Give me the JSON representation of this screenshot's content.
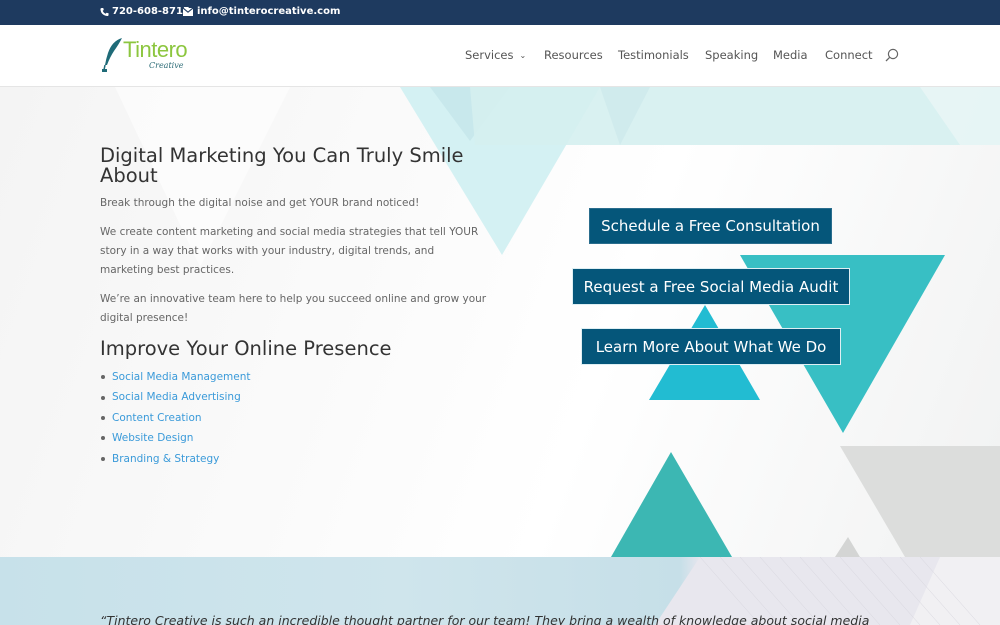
{
  "topbar": {
    "phone": "720-608-8715",
    "email": "info@tinterocreative.com",
    "phone_icon": "phone-icon",
    "email_icon": "envelope-icon"
  },
  "header": {
    "logo": {
      "word": "Tintero",
      "sub": "Creative"
    },
    "nav": [
      {
        "label": "Services",
        "has_dropdown": true
      },
      {
        "label": "Resources"
      },
      {
        "label": "Testimonials"
      },
      {
        "label": "Speaking"
      },
      {
        "label": "Media"
      },
      {
        "label": "Connect"
      }
    ],
    "search_icon": "search-icon"
  },
  "hero": {
    "title": "Digital Marketing You Can Truly Smile About",
    "paragraphs": [
      "Break through the digital noise and get YOUR brand noticed!",
      "We create content marketing and social media strategies that tell YOUR story in a way that works with your industry, digital trends, and marketing best practices.",
      "We’re an innovative team here to help you succeed online and grow your digital presence!"
    ],
    "subtitle": "Improve Your Online Presence",
    "services": [
      "Social Media Management",
      "Social Media Advertising",
      "Content Creation",
      "Website Design",
      "Branding & Strategy"
    ],
    "buttons": [
      "Schedule a Free Consultation",
      "Request a Free Social Media Audit",
      "Learn More About What We Do"
    ]
  },
  "testimonial": {
    "quote": "“Tintero Creative is such an incredible thought partner for our team! They bring a wealth of knowledge about social media"
  },
  "colors": {
    "topbar": "#1e3a5f",
    "button": "#05567a",
    "link": "#3a9ad9",
    "accent_teal": "#3bbdbd",
    "logo_green": "#8cc63f"
  }
}
